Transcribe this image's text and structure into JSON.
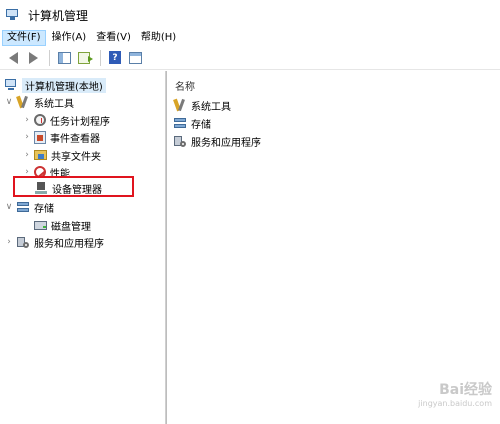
{
  "window": {
    "title": "计算机管理"
  },
  "menu": {
    "items": [
      {
        "label": "文件(F)",
        "active": true
      },
      {
        "label": "操作(A)"
      },
      {
        "label": "查看(V)"
      },
      {
        "label": "帮助(H)"
      }
    ]
  },
  "toolbar": {
    "buttons": [
      "back-icon",
      "forward-icon",
      "show-hide-tree-icon",
      "export-list-icon",
      "help-icon",
      "view-icon"
    ],
    "help_glyph": "?"
  },
  "tree": {
    "root": "计算机管理(本地)",
    "system_tools": "系统工具",
    "task_scheduler": "任务计划程序",
    "event_viewer": "事件查看器",
    "shared_folders": "共享文件夹",
    "performance": "性能",
    "device_manager": "设备管理器",
    "storage": "存储",
    "disk_management": "磁盘管理",
    "services_apps": "服务和应用程序"
  },
  "right_pane": {
    "column_header": "名称",
    "items": [
      "系统工具",
      "存储",
      "服务和应用程序"
    ]
  },
  "highlight": {
    "target": "设备管理器",
    "color": "#e0141e"
  },
  "watermark": {
    "main": "Bai经验",
    "sub": "jingyan.baidu.com"
  }
}
